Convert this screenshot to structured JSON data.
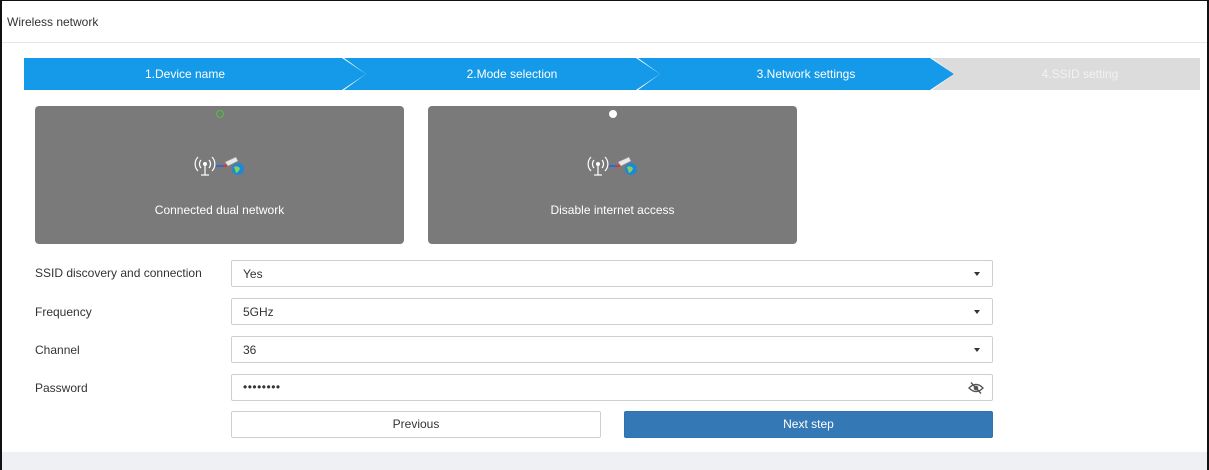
{
  "window": {
    "title": "Wireless network"
  },
  "stepper": {
    "steps": [
      {
        "label": "1.Device name",
        "state": "done"
      },
      {
        "label": "2.Mode selection",
        "state": "done"
      },
      {
        "label": "3.Network settings",
        "state": "active"
      },
      {
        "label": "4.SSID setting",
        "state": "pending"
      }
    ]
  },
  "modes": [
    {
      "label": "Connected dual network",
      "selected": true,
      "icon": "network-bridge-icon"
    },
    {
      "label": "Disable internet access",
      "selected": false,
      "icon": "network-bridge-icon"
    }
  ],
  "form": {
    "ssid": {
      "label": "SSID discovery and connection",
      "value": "Yes"
    },
    "frequency": {
      "label": "Frequency",
      "value": "5GHz"
    },
    "channel": {
      "label": "Channel",
      "value": "36"
    },
    "password": {
      "label": "Password",
      "value": "••••••••",
      "icon": "eye-slash-icon"
    }
  },
  "buttons": {
    "previous": "Previous",
    "next": "Next step"
  },
  "colors": {
    "step_active": "#149ae8",
    "step_pending": "#dcdcdc",
    "card_bg": "#7a7a7a",
    "primary_button": "#3478b6",
    "radio_selected": "#4cc43b"
  }
}
